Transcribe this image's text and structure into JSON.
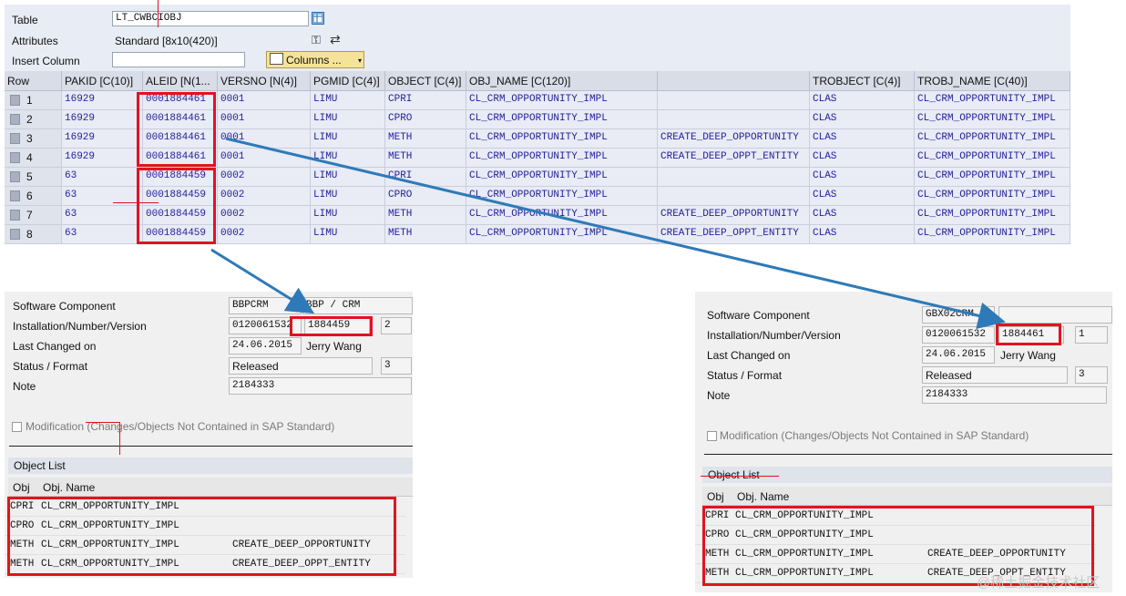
{
  "header": {
    "table_label": "Table",
    "table_value": "LT_CWBCIOBJ",
    "attributes_label": "Attributes",
    "attributes_value": "Standard [8x10(420)]",
    "insert_column_label": "Insert Column",
    "insert_column_value": "",
    "columns_button": "Columns ..."
  },
  "grid": {
    "columns": [
      "Row",
      "PAKID [C(10)]",
      "ALEID [N(1...",
      "VERSNO [N(4)]",
      "PGMID [C(4)]",
      "OBJECT [C(4)]",
      "OBJ_NAME [C(120)]",
      "",
      "TROBJECT [C(4)]",
      "TROBJ_NAME [C(40)]"
    ],
    "rows": [
      [
        "1",
        "16929",
        "0001884461",
        "0001",
        "LIMU",
        "CPRI",
        "CL_CRM_OPPORTUNITY_IMPL",
        "",
        "CLAS",
        "CL_CRM_OPPORTUNITY_IMPL"
      ],
      [
        "2",
        "16929",
        "0001884461",
        "0001",
        "LIMU",
        "CPRO",
        "CL_CRM_OPPORTUNITY_IMPL",
        "",
        "CLAS",
        "CL_CRM_OPPORTUNITY_IMPL"
      ],
      [
        "3",
        "16929",
        "0001884461",
        "0001",
        "LIMU",
        "METH",
        "CL_CRM_OPPORTUNITY_IMPL",
        "CREATE_DEEP_OPPORTUNITY",
        "CLAS",
        "CL_CRM_OPPORTUNITY_IMPL"
      ],
      [
        "4",
        "16929",
        "0001884461",
        "0001",
        "LIMU",
        "METH",
        "CL_CRM_OPPORTUNITY_IMPL",
        "CREATE_DEEP_OPPT_ENTITY",
        "CLAS",
        "CL_CRM_OPPORTUNITY_IMPL"
      ],
      [
        "5",
        "63",
        "0001884459",
        "0002",
        "LIMU",
        "CPRI",
        "CL_CRM_OPPORTUNITY_IMPL",
        "",
        "CLAS",
        "CL_CRM_OPPORTUNITY_IMPL"
      ],
      [
        "6",
        "63",
        "0001884459",
        "0002",
        "LIMU",
        "CPRO",
        "CL_CRM_OPPORTUNITY_IMPL",
        "",
        "CLAS",
        "CL_CRM_OPPORTUNITY_IMPL"
      ],
      [
        "7",
        "63",
        "0001884459",
        "0002",
        "LIMU",
        "METH",
        "CL_CRM_OPPORTUNITY_IMPL",
        "CREATE_DEEP_OPPORTUNITY",
        "CLAS",
        "CL_CRM_OPPORTUNITY_IMPL"
      ],
      [
        "8",
        "63",
        "0001884459",
        "0002",
        "LIMU",
        "METH",
        "CL_CRM_OPPORTUNITY_IMPL",
        "CREATE_DEEP_OPPT_ENTITY",
        "CLAS",
        "CL_CRM_OPPORTUNITY_IMPL"
      ]
    ]
  },
  "left_panel": {
    "software_component_label": "Software Component",
    "software_component_value": "BBPCRM",
    "software_component_desc": "BBP / CRM",
    "installation_label": "Installation/Number/Version",
    "installation_value": "0120061532",
    "number_value": "1884459",
    "version_value": "2",
    "last_changed_label": "Last Changed on",
    "last_changed_value": "24.06.2015",
    "last_changed_by": "Jerry Wang",
    "status_label": "Status / Format",
    "status_value": "Released",
    "format_value": "3",
    "note_label": "Note",
    "note_value": "2184333",
    "modification_label": "Modification (Changes/Objects Not Contained in SAP Standard)",
    "object_list_title": "Object List",
    "ol_col_obj": "Obj",
    "ol_col_name": "Obj. Name",
    "objects": [
      {
        "obj": "CPRI",
        "name": "CL_CRM_OPPORTUNITY_IMPL",
        "sub": ""
      },
      {
        "obj": "CPRO",
        "name": "CL_CRM_OPPORTUNITY_IMPL",
        "sub": ""
      },
      {
        "obj": "METH",
        "name": "CL_CRM_OPPORTUNITY_IMPL",
        "sub": "CREATE_DEEP_OPPORTUNITY"
      },
      {
        "obj": "METH",
        "name": "CL_CRM_OPPORTUNITY_IMPL",
        "sub": "CREATE_DEEP_OPPT_ENTITY"
      }
    ]
  },
  "right_panel": {
    "software_component_label": "Software Component",
    "software_component_value": "GBX02CRM",
    "software_component_desc": "",
    "installation_label": "Installation/Number/Version",
    "installation_value": "0120061532",
    "number_value": "1884461",
    "version_value": "1",
    "last_changed_label": "Last Changed on",
    "last_changed_value": "24.06.2015",
    "last_changed_by": "Jerry Wang",
    "status_label": "Status / Format",
    "status_value": "Released",
    "format_value": "3",
    "note_label": "Note",
    "note_value": "2184333",
    "modification_label": "Modification (Changes/Objects Not Contained in SAP Standard)",
    "object_list_title": "Object List",
    "ol_col_obj": "Obj",
    "ol_col_name": "Obj. Name",
    "objects": [
      {
        "obj": "CPRI",
        "name": "CL_CRM_OPPORTUNITY_IMPL",
        "sub": ""
      },
      {
        "obj": "CPRO",
        "name": "CL_CRM_OPPORTUNITY_IMPL",
        "sub": ""
      },
      {
        "obj": "METH",
        "name": "CL_CRM_OPPORTUNITY_IMPL",
        "sub": "CREATE_DEEP_OPPORTUNITY"
      },
      {
        "obj": "METH",
        "name": "CL_CRM_OPPORTUNITY_IMPL",
        "sub": "CREATE_DEEP_OPPT_ENTITY"
      }
    ]
  },
  "watermark": "@稀土掘金技术社区",
  "colors": {
    "highlight": "#e2131e",
    "arrow": "#2e7ab8"
  }
}
